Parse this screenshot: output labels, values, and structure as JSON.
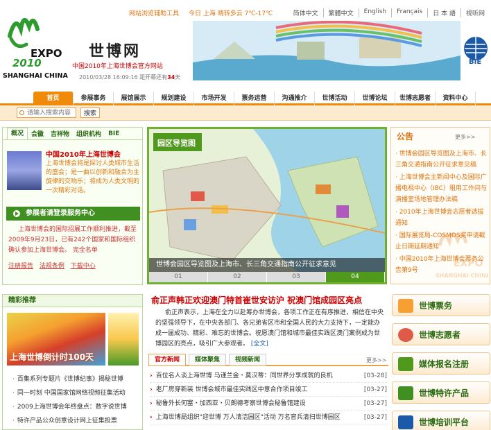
{
  "header": {
    "site_name": "世博网",
    "site_subtitle": "中国2010年上海世博会官方网站",
    "datetime": "2010/03/28 16:09:16",
    "countdown_prefix": "距开幕还有",
    "countdown_days": "34",
    "countdown_suffix": "天",
    "tool": "网站浏览辅助工具",
    "weather": "今日 上海 晴转多云 7℃-17℃",
    "languages": [
      "简体中文",
      "繁體中文",
      "English",
      "Français",
      "日 本 語",
      "视听网"
    ],
    "bie": "BIE",
    "expo_logo_text": "EXPO",
    "expo_logo_year": "2010",
    "expo_logo_city": "SHANGHAI CHINA"
  },
  "nav": {
    "items": [
      "首页",
      "参展事务",
      "展馆展示",
      "规划建设",
      "市场开发",
      "票务运营",
      "沟通推介",
      "世博活动",
      "世博论坛",
      "世博志愿者",
      "资料中心"
    ]
  },
  "search": {
    "placeholder": "请输入搜索内容",
    "button": "搜索"
  },
  "left": {
    "tabs": [
      "概况",
      "会徽",
      "吉祥物",
      "组织机构",
      "BIE"
    ],
    "intro_title": "中国2010年上海世博会",
    "intro_text": "上海世博会将是探讨人类城市生活的盛会；是一曲以创新和融合为主旋律的交响乐；将成为人类文明的一次精彩对话。",
    "visitor_button": "参展者请登录服务中心",
    "participation_text": "上海世博会的国际招展工作顺利推进，截至2009年9月23日，已有242个国家和国际组织确认参加上海世博会。",
    "participation_link": "完全名单",
    "links": [
      "注册报告",
      "法规条例",
      "下载中心"
    ]
  },
  "recommend": {
    "title": "精彩推荐",
    "banner_text": "上海世博倒计时100天",
    "items": [
      "百集系列专题片《世博纪事》揭秘世博",
      "同一时刻 中国国家馆网络视频征集活动",
      "2009上海世博会年终盘点：数字说世博",
      "特许产品公众创意设计网上征集投票"
    ]
  },
  "map": {
    "caption": "世博会园区导览图及上海市、长三角交通指南公开征求意见",
    "pages": [
      "01",
      "02",
      "03",
      "04"
    ],
    "active_page": 3,
    "map_title": "园区导览图"
  },
  "headline": {
    "title": "俞正声韩正欢迎澳门特首崔世安访沪 祝澳门馆成园区亮点",
    "body": "俞正声表示，上海在全力以赴筹办世博会，各项工作正在有序推进，相信在中央的坚强领导下，在中央各部门、各兄弟省区市和全国人民的大力支持下，一定能办成一届成功、精彩、难忘的世博会。祝愿澳门馆和城市最佳实践区澳门案例成为世博园区的亮点，吸引广大参观者。",
    "more": "[全文]"
  },
  "news": {
    "tabs": [
      "官方新闻",
      "媒体聚焦",
      "视频新闻"
    ],
    "more": "更多>>",
    "items": [
      {
        "title": "百位名人谈上海世博 马谨兰金・莫汉蒂：同世界分享成就的良机",
        "date": "[03-28]"
      },
      {
        "title": "老厂房穿新装 世博会城市最佳实践区中意合作项目竣工",
        "date": "[03-27]"
      },
      {
        "title": "秘鲁外长何塞・加西亚・贝朗德考察世博会秘鲁馆建设",
        "date": "[03-27]"
      },
      {
        "title": "上海世博局组织\"迎世博 万人清洁园区\"活动 万名官兵清扫世博园区",
        "date": "[03-27]"
      }
    ]
  },
  "notice": {
    "title": "公告",
    "more": "更多>>",
    "items": [
      "世博会园区导览图及上海市、长三角交通指南公开征求意见稿",
      "上海世博会主新闻中心及国际广播电视中心（IBC）租用工作间与演播室场地管理办法稿",
      "2010年上海世博会志愿者选拔通知",
      "国际展览局-COSMOS奖申请截止日期延期通知",
      "中国2010年上海世博会票务公告第9号"
    ]
  },
  "side_buttons": [
    "世博票务",
    "世博志愿者",
    "媒体报名注册",
    "世博特许产品",
    "世博培训平台"
  ],
  "colors": {
    "accent": "#f08a0a",
    "green": "#3f8f21",
    "red": "#cc0000"
  }
}
